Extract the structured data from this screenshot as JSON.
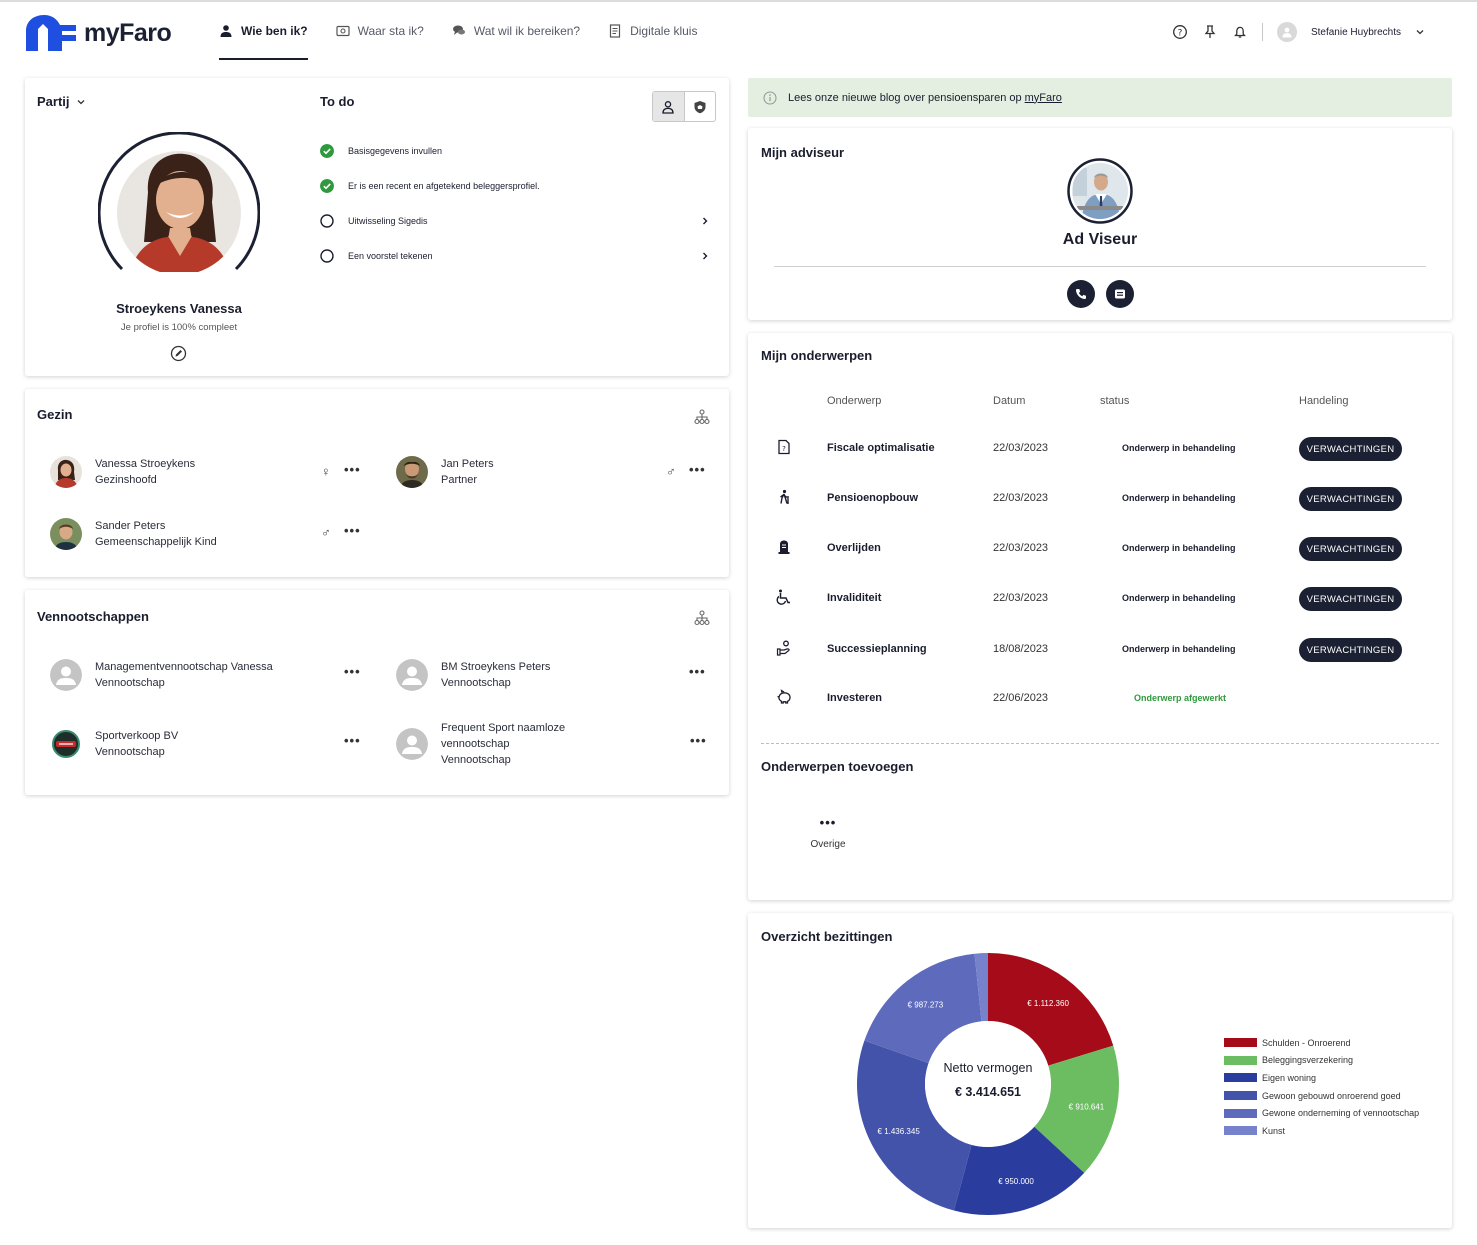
{
  "brand": {
    "name": "myFaro",
    "accent": "#1e4fe0"
  },
  "nav": {
    "items": [
      {
        "label": "Wie ben ik?",
        "icon": "person-icon",
        "active": true
      },
      {
        "label": "Waar sta ik?",
        "icon": "safe-icon",
        "active": false
      },
      {
        "label": "Wat wil ik bereiken?",
        "icon": "chat-icon",
        "active": false
      },
      {
        "label": "Digitale kluis",
        "icon": "document-icon",
        "active": false
      }
    ]
  },
  "header": {
    "icons": [
      "help-icon",
      "pin-icon",
      "bell-icon"
    ],
    "user_name": "Stefanie Huybrechts"
  },
  "partij": {
    "title": "Partij",
    "name": "Stroeykens Vanessa",
    "profile_text": "Je profiel is 100% compleet",
    "completion_percent": 100
  },
  "todo": {
    "title": "To do",
    "items": [
      {
        "label": "Basisgegevens invullen",
        "done": true
      },
      {
        "label": "Er is een recent en afgetekend beleggersprofiel.",
        "done": true
      },
      {
        "label": "Uitwisseling Sigedis",
        "done": false
      },
      {
        "label": "Een voorstel tekenen",
        "done": false
      }
    ]
  },
  "gezin": {
    "title": "Gezin",
    "members": [
      {
        "name": "Vanessa Stroeykens",
        "role": "Gezinshoofd",
        "gender": "♀"
      },
      {
        "name": "Jan Peters",
        "role": "Partner",
        "gender": "♂"
      },
      {
        "name": "Sander Peters",
        "role": "Gemeenschappelijk Kind",
        "gender": "♂"
      }
    ]
  },
  "vennootschappen": {
    "title": "Vennootschappen",
    "items": [
      {
        "name": "Managementvennootschap Vanessa",
        "role": "Vennootschap"
      },
      {
        "name": "BM Stroeykens Peters",
        "role": "Vennootschap"
      },
      {
        "name": "Sportverkoop BV",
        "role": "Vennootschap"
      },
      {
        "name_line1": "Frequent Sport naamloze",
        "name_line2": "vennootschap",
        "role": "Vennootschap"
      }
    ]
  },
  "banner": {
    "text": "Lees onze nieuwe blog over pensioensparen op",
    "link": "myFaro"
  },
  "adviseur": {
    "title": "Mijn adviseur",
    "name": "Ad Viseur"
  },
  "onderwerpen": {
    "title": "Mijn onderwerpen",
    "columns": [
      "Onderwerp",
      "Datum",
      "status",
      "Handeling"
    ],
    "rows": [
      {
        "icon": "tax-document-icon",
        "name": "Fiscale optimalisatie",
        "date": "22/03/2023",
        "status": "Onderwerp in behandeling",
        "action": "VERWACHTINGEN"
      },
      {
        "icon": "walking-person-icon",
        "name": "Pensioenopbouw",
        "date": "22/03/2023",
        "status": "Onderwerp in behandeling",
        "action": "VERWACHTINGEN"
      },
      {
        "icon": "tombstone-icon",
        "name": "Overlijden",
        "date": "22/03/2023",
        "status": "Onderwerp in behandeling",
        "action": "VERWACHTINGEN"
      },
      {
        "icon": "wheelchair-icon",
        "name": "Invaliditeit",
        "date": "22/03/2023",
        "status": "Onderwerp in behandeling",
        "action": "VERWACHTINGEN"
      },
      {
        "icon": "hand-person-icon",
        "name": "Successieplanning",
        "date": "18/08/2023",
        "status": "Onderwerp in behandeling",
        "action": "VERWACHTINGEN"
      },
      {
        "icon": "piggy-bank-icon",
        "name": "Investeren",
        "date": "22/06/2023",
        "status": "Onderwerp afgewerkt",
        "action": ""
      }
    ],
    "add_title": "Onderwerpen toevoegen",
    "add_item": "Overige"
  },
  "bezittingen": {
    "title": "Overzicht bezittingen",
    "center_label": "Netto vermogen",
    "center_value": "€ 3.414.651"
  },
  "chart_data": {
    "type": "pie",
    "donut": true,
    "series": [
      {
        "name": "Schulden - Onroerend",
        "value": 1112360,
        "label": "€ 1.112.360",
        "color": "#a50b18"
      },
      {
        "name": "Beleggingsverzekering",
        "value": 910641,
        "label": "€ 910.641",
        "color": "#6cbd62"
      },
      {
        "name": "Eigen woning",
        "value": 950000,
        "label": "€ 950.000",
        "color": "#2a3d9e"
      },
      {
        "name": "Gewoon gebouwd onroerend goed",
        "value": 1436345,
        "label": "€ 1.436.345",
        "color": "#4453aa"
      },
      {
        "name": "Gewone onderneming of vennootschap",
        "value": 987273,
        "label": "€ 987.273",
        "color": "#5e6bbc"
      },
      {
        "name": "Kunst",
        "value": 90000,
        "label": "",
        "color": "#7782cc"
      }
    ],
    "legend_position": "right"
  }
}
